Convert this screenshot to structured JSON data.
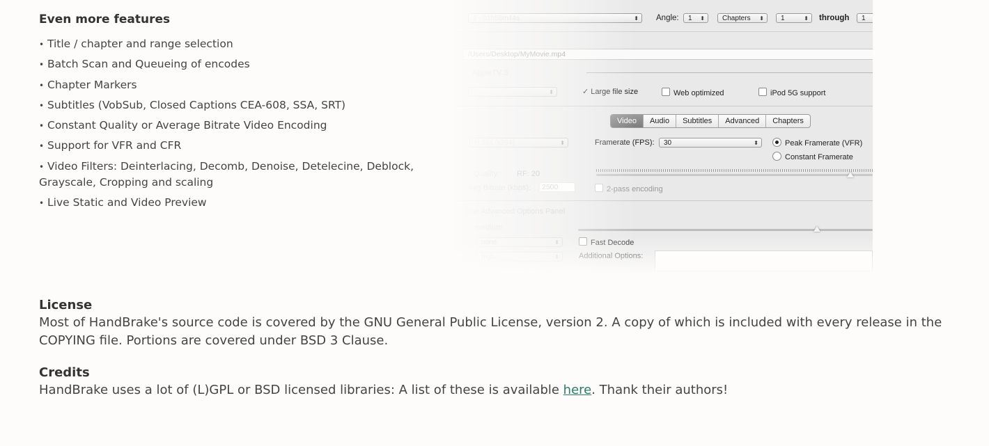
{
  "features": {
    "title": "Even more features",
    "items": [
      "Title / chapter and range selection",
      "Batch Scan and Queueing of encodes",
      "Chapter Markers",
      "Subtitles (VobSub, Closed Captions CEA-608, SSA, SRT)",
      "Constant Quality or Average Bitrate Video Encoding",
      "Support for VFR and CFR",
      "Video Filters: Deinterlacing, Decomb, Denoise, Detelecine, Deblock, Grayscale, Cropping and scaling",
      "Live Static and Video Preview"
    ],
    "bullet": "•"
  },
  "screenshot": {
    "angle_label": "Angle:",
    "angle_value": "1",
    "range_type": "Chapters",
    "range_start": "1",
    "through_label": "through",
    "range_end": "1",
    "dest_path": "/Users/Desktop/MyMovie.mp4",
    "preset": "AppleTV 3",
    "large_file": "Large file size",
    "web_optimized": "Web optimized",
    "ipod_support": "iPod 5G support",
    "tabs": [
      "Video",
      "Audio",
      "Subtitles",
      "Advanced",
      "Chapters"
    ],
    "video_codec": "H.264 (x264)",
    "framerate_label": "Framerate (FPS):",
    "framerate_value": "30",
    "peak_framerate": "Peak Framerate (VFR)",
    "constant_framerate": "Constant Framerate",
    "quality_label": "Quality:",
    "rf_label": "RF:",
    "rf_value": "20",
    "bitrate_label": "Avg Bitrate (kbps):",
    "bitrate_value": "2500",
    "two_pass": "2-pass encoding",
    "advanced_panel": "Use Advanced Options Panel",
    "x264_preset": "medium",
    "tune_value": "none",
    "profile_value": "high",
    "fast_decode": "Fast Decode",
    "additional_options": "Additional Options:"
  },
  "license": {
    "title": "License",
    "text": "Most of HandBrake's source code is covered by the GNU General Public License, version 2. A copy of which is included with every release in the COPYING file. Portions are covered under BSD 3 Clause."
  },
  "credits": {
    "title": "Credits",
    "text_before": "HandBrake uses a lot of (L)GPL or BSD licensed libraries: A list of these is available ",
    "link": "here",
    "text_after": ". Thank their authors!"
  }
}
